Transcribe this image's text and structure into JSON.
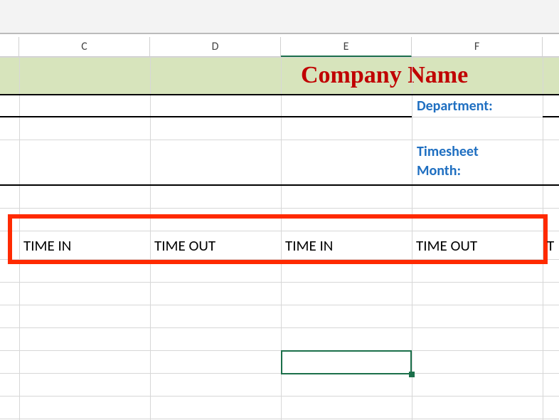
{
  "columns": {
    "C": "C",
    "D": "D",
    "E": "E",
    "F": "F"
  },
  "active_column": "E",
  "band": {
    "title": "Company Name"
  },
  "fields": {
    "department": "Department:",
    "timesheet_month_l1": "Timesheet",
    "timesheet_month_l2": "Month:"
  },
  "headers": {
    "c": "TIME IN",
    "d": "TIME OUT",
    "e": "TIME IN",
    "f": "TIME OUT",
    "g_partial": "T"
  },
  "colors": {
    "band": "#d7e4bc",
    "title": "#c00000",
    "label": "#1f6fc1",
    "sel": "#1b6f4a",
    "hilite": "#ff2a00"
  },
  "chart_data": null
}
